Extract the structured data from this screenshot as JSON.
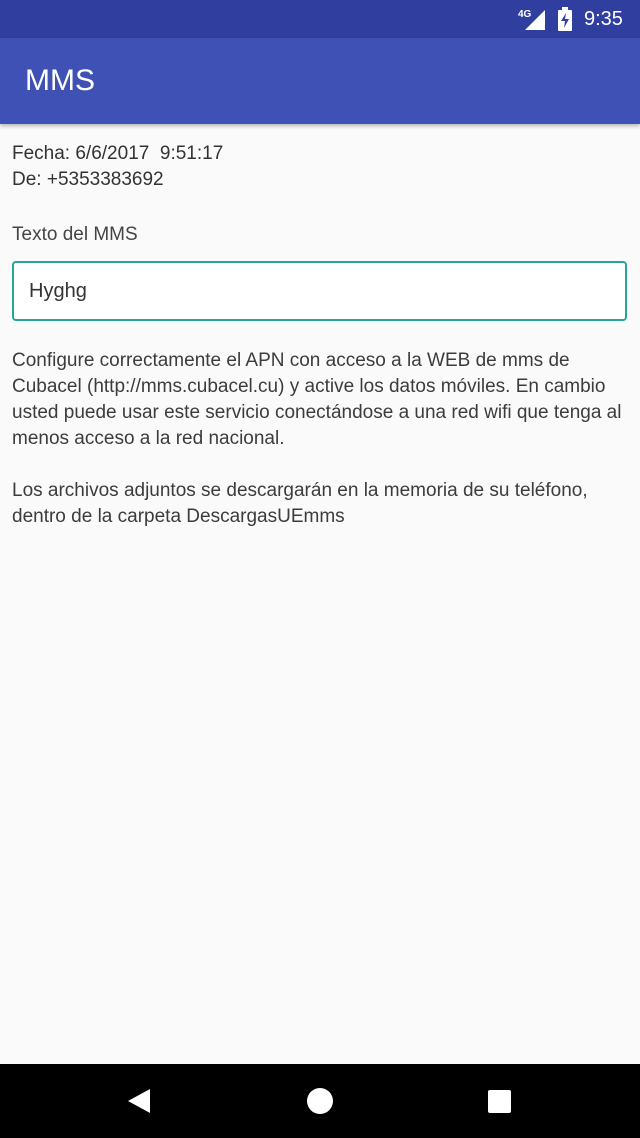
{
  "status_bar": {
    "network": "4G",
    "time": "9:35"
  },
  "app_bar": {
    "title": "MMS"
  },
  "message": {
    "date_line": "Fecha: 6/6/2017  9:51:17",
    "from_line": "De: +5353383692",
    "text_label": "Texto del MMS",
    "text_value": "Hyghg"
  },
  "info": {
    "apn_notice": "Configure correctamente el APN con acceso a la WEB de mms de Cubacel (http://mms.cubacel.cu) y active los datos móviles. En cambio usted puede usar este servicio conectándose a una red wifi que tenga al menos acceso a la red nacional.",
    "attachments_notice": "Los archivos adjuntos se descargarán en la memoria de su teléfono, dentro de la carpeta DescargasUEmms"
  },
  "navigation": {
    "back": "back-icon",
    "home": "home-icon",
    "recents": "recents-icon"
  },
  "colors": {
    "status_bar": "#303f9f",
    "app_bar": "#3f51b5",
    "field_border": "#26a69a",
    "background": "#fafafa",
    "nav_bar": "#000000"
  }
}
